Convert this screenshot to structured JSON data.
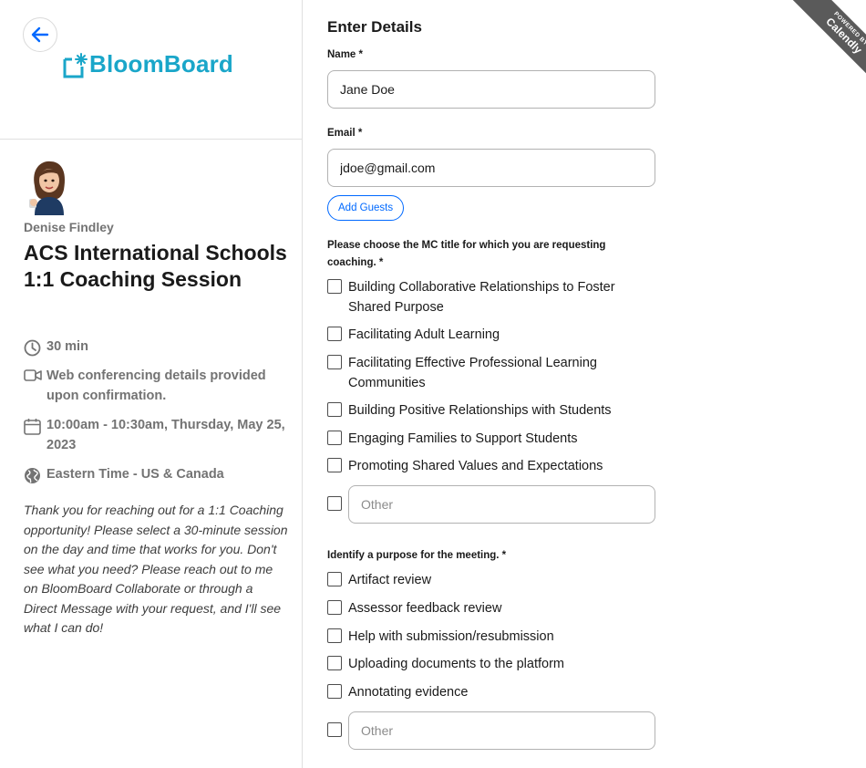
{
  "brand": {
    "logo_text": "BloomBoard",
    "logo_color": "#1aa6c9",
    "accent": "#0069ff"
  },
  "ribbon": {
    "powered": "POWERED BY",
    "name": "Calendly"
  },
  "event": {
    "host": "Denise Findley",
    "title": "ACS International Schools 1:1 Coaching Session",
    "duration": "30 min",
    "location": "Web conferencing details provided upon confirmation.",
    "datetime": "10:00am - 10:30am, Thursday, May 25, 2023",
    "timezone": "Eastern Time - US & Canada",
    "description": "Thank you for reaching out for a 1:1 Coaching opportunity! Please select a 30-minute session on the day and time that works for you. Don't see what you need? Please reach out to me on BloomBoard Collaborate or through a Direct Message with your request, and I'll see what I can do!"
  },
  "form": {
    "heading": "Enter Details",
    "name_label": "Name *",
    "name_value": "Jane Doe",
    "email_label": "Email *",
    "email_value": "jdoe@gmail.com",
    "add_guests": "Add Guests",
    "q1_label": "Please choose the MC title for which you are requesting coaching. *",
    "q1_options": [
      "Building Collaborative Relationships to Foster Shared Purpose",
      "Facilitating Adult Learning",
      "Facilitating Effective Professional Learning Communities",
      "Building Positive Relationships with Students",
      "Engaging Families to Support Students",
      "Promoting Shared Values and Expectations"
    ],
    "q1_other_placeholder": "Other",
    "q2_label": "Identify a purpose for the meeting. *",
    "q2_options": [
      "Artifact review",
      "Assessor feedback review",
      "Help with submission/resubmission",
      "Uploading documents to the platform",
      "Annotating evidence"
    ],
    "q2_other_placeholder": "Other"
  }
}
